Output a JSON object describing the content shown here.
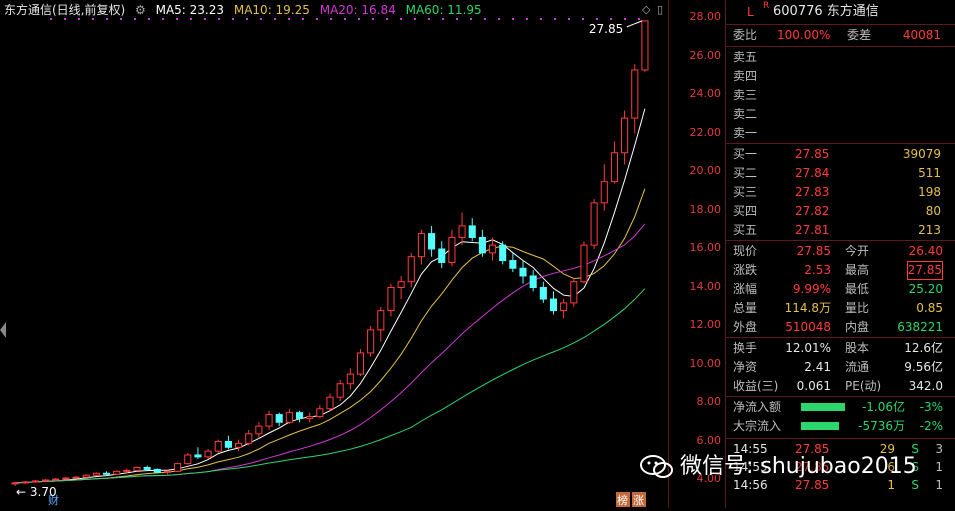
{
  "legend": {
    "title": "东方通信(日线,前复权)",
    "ma5": "MA5: 23.23",
    "ma10": "MA10: 19.25",
    "ma20": "MA20: 16.84",
    "ma60": "MA60: 11.95",
    "colors": {
      "ma5": "#ffffff",
      "ma10": "#e6c04a",
      "ma20": "#d23ad2",
      "ma60": "#2bd66a"
    }
  },
  "axis_ticks": [
    "28.00",
    "26.00",
    "24.00",
    "22.00",
    "20.00",
    "18.00",
    "16.00",
    "14.00",
    "12.00",
    "10.00",
    "8.00",
    "6.00",
    "4.00"
  ],
  "chart_data": {
    "type": "candlestick",
    "high_label": "27.85",
    "low_label": "3.70",
    "markers": {
      "left": "财",
      "right_a": "榜",
      "right_b": "涨"
    },
    "ylim": [
      4,
      28
    ],
    "candles": [
      [
        3.8,
        3.9,
        3.7,
        3.85
      ],
      [
        3.85,
        3.95,
        3.8,
        3.9
      ],
      [
        3.9,
        4.0,
        3.85,
        3.95
      ],
      [
        3.95,
        4.05,
        3.9,
        4.0
      ],
      [
        4.0,
        4.1,
        3.95,
        4.05
      ],
      [
        4.05,
        4.15,
        4.0,
        4.1
      ],
      [
        4.1,
        4.2,
        4.05,
        4.15
      ],
      [
        4.15,
        4.3,
        4.1,
        4.25
      ],
      [
        4.25,
        4.4,
        4.2,
        4.35
      ],
      [
        4.35,
        4.45,
        4.25,
        4.3
      ],
      [
        4.3,
        4.5,
        4.25,
        4.45
      ],
      [
        4.45,
        4.6,
        4.35,
        4.5
      ],
      [
        4.5,
        4.7,
        4.45,
        4.65
      ],
      [
        4.65,
        4.75,
        4.5,
        4.55
      ],
      [
        4.55,
        4.6,
        4.35,
        4.4
      ],
      [
        4.4,
        4.5,
        4.3,
        4.45
      ],
      [
        4.45,
        4.9,
        4.4,
        4.85
      ],
      [
        4.85,
        5.4,
        4.8,
        5.3
      ],
      [
        5.3,
        5.7,
        5.1,
        5.2
      ],
      [
        5.2,
        5.6,
        5.1,
        5.5
      ],
      [
        5.5,
        6.1,
        5.4,
        6.0
      ],
      [
        6.0,
        6.3,
        5.6,
        5.7
      ],
      [
        5.7,
        6.1,
        5.5,
        5.9
      ],
      [
        5.9,
        6.6,
        5.8,
        6.4
      ],
      [
        6.4,
        7.0,
        6.2,
        6.8
      ],
      [
        6.8,
        7.6,
        6.6,
        7.4
      ],
      [
        7.4,
        7.5,
        6.8,
        7.0
      ],
      [
        7.0,
        7.7,
        6.9,
        7.5
      ],
      [
        7.5,
        7.6,
        7.0,
        7.2
      ],
      [
        7.2,
        7.5,
        7.0,
        7.3
      ],
      [
        7.3,
        7.9,
        7.2,
        7.7
      ],
      [
        7.7,
        8.5,
        7.6,
        8.3
      ],
      [
        8.3,
        9.2,
        8.1,
        9.0
      ],
      [
        9.0,
        9.8,
        8.7,
        9.5
      ],
      [
        9.5,
        10.8,
        9.4,
        10.6
      ],
      [
        10.6,
        12.0,
        10.4,
        11.8
      ],
      [
        11.8,
        13.0,
        11.2,
        12.8
      ],
      [
        12.8,
        14.2,
        12.5,
        14.0
      ],
      [
        14.0,
        14.6,
        13.4,
        14.3
      ],
      [
        14.3,
        15.8,
        14.0,
        15.6
      ],
      [
        15.6,
        17.0,
        15.2,
        16.8
      ],
      [
        16.8,
        17.2,
        15.6,
        16.0
      ],
      [
        16.0,
        16.4,
        15.0,
        15.3
      ],
      [
        15.3,
        17.0,
        15.1,
        16.6
      ],
      [
        16.6,
        17.9,
        16.2,
        17.2
      ],
      [
        17.2,
        17.6,
        16.4,
        16.6
      ],
      [
        16.6,
        17.0,
        15.6,
        15.8
      ],
      [
        15.8,
        16.6,
        15.4,
        16.2
      ],
      [
        16.2,
        16.4,
        15.2,
        15.4
      ],
      [
        15.4,
        15.8,
        14.8,
        15.0
      ],
      [
        15.0,
        15.4,
        14.2,
        14.6
      ],
      [
        14.6,
        14.9,
        13.8,
        14.0
      ],
      [
        14.0,
        14.3,
        13.2,
        13.4
      ],
      [
        13.4,
        13.8,
        12.6,
        12.8
      ],
      [
        12.8,
        13.4,
        12.4,
        13.2
      ],
      [
        13.2,
        14.5,
        13.0,
        14.3
      ],
      [
        14.3,
        16.4,
        14.2,
        16.2
      ],
      [
        16.2,
        18.6,
        16.0,
        18.4
      ],
      [
        18.4,
        20.4,
        18.0,
        19.5
      ],
      [
        19.5,
        21.6,
        19.4,
        21.0
      ],
      [
        21.0,
        23.2,
        20.4,
        22.8
      ],
      [
        22.8,
        25.6,
        22.0,
        25.3
      ],
      [
        25.3,
        27.85,
        25.2,
        27.85
      ]
    ]
  },
  "panel": {
    "marker_l": "L",
    "marker_r": "R",
    "title": "600776 东方通信",
    "weibi_label": "委比",
    "weibi": "100.00%",
    "weicha_label": "委差",
    "weicha": "40081",
    "sells": [
      {
        "label": "卖五"
      },
      {
        "label": "卖四"
      },
      {
        "label": "卖三"
      },
      {
        "label": "卖二"
      },
      {
        "label": "卖一"
      }
    ],
    "buys": [
      {
        "label": "买一",
        "price": "27.85",
        "vol": "39079"
      },
      {
        "label": "买二",
        "price": "27.84",
        "vol": "511"
      },
      {
        "label": "买三",
        "price": "27.83",
        "vol": "198"
      },
      {
        "label": "买四",
        "price": "27.82",
        "vol": "80"
      },
      {
        "label": "买五",
        "price": "27.81",
        "vol": "213"
      }
    ],
    "quote": [
      {
        "l1": "现价",
        "v1": "27.85",
        "l2": "今开",
        "v2": "26.40"
      },
      {
        "l1": "涨跌",
        "v1": "2.53",
        "l2": "最高",
        "v2": "27.85"
      },
      {
        "l1": "涨幅",
        "v1": "9.99%",
        "l2": "最低",
        "v2": "25.20"
      },
      {
        "l1": "总量",
        "v1": "114.8万",
        "l2": "量比",
        "v2": "0.85"
      },
      {
        "l1": "外盘",
        "v1": "510048",
        "l2": "内盘",
        "v2": "638221"
      }
    ],
    "fund": [
      {
        "l1": "换手",
        "v1": "12.01%",
        "l2": "股本",
        "v2": "12.6亿"
      },
      {
        "l1": "净资",
        "v1": "2.41",
        "l2": "流通",
        "v2": "9.56亿"
      },
      {
        "l1": "收益(三)",
        "v1": "0.061",
        "l2": "PE(动)",
        "v2": "342.0"
      }
    ],
    "flows": [
      {
        "label": "净流入额",
        "value": "-1.06亿",
        "pct": "-3%"
      },
      {
        "label": "大宗流入",
        "value": "-5736万",
        "pct": "-2%"
      }
    ],
    "ticks": [
      {
        "time": "14:55",
        "price": "27.85",
        "vol": "29",
        "side": "S",
        "n": "3"
      },
      {
        "time": "14:55",
        "price": "27.85",
        "vol": "6",
        "side": "S",
        "n": "1"
      },
      {
        "time": "14:56",
        "price": "27.85",
        "vol": "1",
        "side": "S",
        "n": "1"
      }
    ]
  },
  "watermark": "微信号: shujubao2015"
}
